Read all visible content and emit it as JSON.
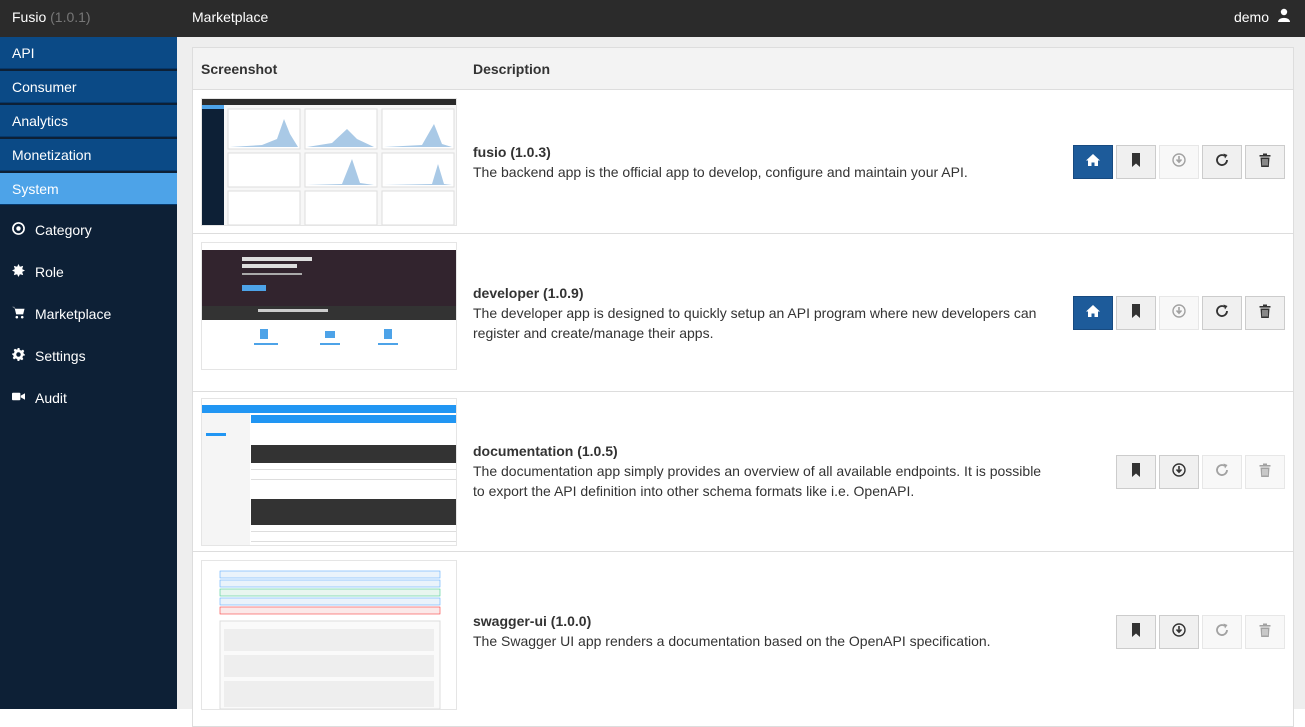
{
  "topbar": {
    "app_name": "Fusio",
    "app_version": "(1.0.1)",
    "page_title": "Marketplace",
    "user": "demo"
  },
  "sidebar": {
    "main": [
      "API",
      "Consumer",
      "Analytics",
      "Monetization",
      "System"
    ],
    "sub": [
      {
        "label": "Category",
        "icon": "target-icon"
      },
      {
        "label": "Role",
        "icon": "badge-icon"
      },
      {
        "label": "Marketplace",
        "icon": "cart-icon"
      },
      {
        "label": "Settings",
        "icon": "gear-icon"
      },
      {
        "label": "Audit",
        "icon": "video-icon"
      }
    ]
  },
  "table": {
    "headers": {
      "screenshot": "Screenshot",
      "description": "Description"
    },
    "rows": [
      {
        "name": "fusio (1.0.3)",
        "text": "The backend app is the official app to develop, configure and maintain your API.",
        "home": true,
        "bookmark": true,
        "download": false,
        "update": true,
        "delete": true
      },
      {
        "name": "developer (1.0.9)",
        "text": "The developer app is designed to quickly setup an API program where new developers can register and create/manage their apps.",
        "home": true,
        "bookmark": true,
        "download": false,
        "update": true,
        "delete": true
      },
      {
        "name": "documentation (1.0.5)",
        "text": "The documentation app simply provides an overview of all available endpoints. It is possible to export the API definition into other schema formats like i.e. OpenAPI.",
        "home": false,
        "bookmark": true,
        "download": true,
        "update": false,
        "delete": false
      },
      {
        "name": "swagger-ui (1.0.0)",
        "text": "The Swagger UI app renders a documentation based on the OpenAPI specification.",
        "home": false,
        "bookmark": true,
        "download": true,
        "update": false,
        "delete": false
      }
    ]
  },
  "colors": {
    "topbar": "#2b2b2b",
    "sidebar": "#0d2036",
    "sidebar_item": "#0b4a86",
    "sidebar_active": "#4da3e8",
    "primary_button": "#1d5b9a"
  }
}
